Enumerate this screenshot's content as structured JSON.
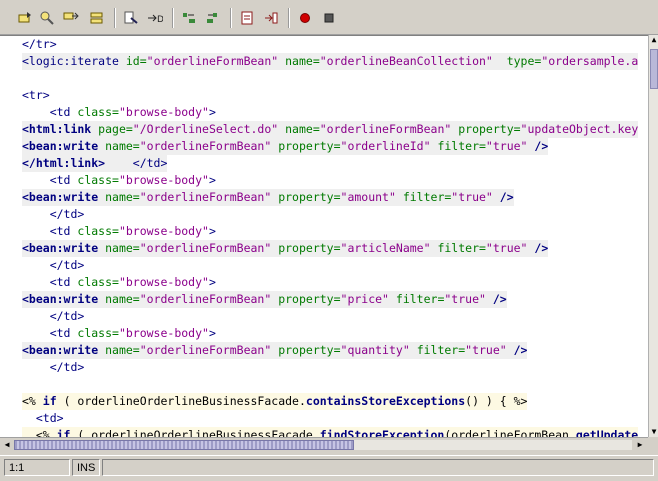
{
  "toolbar": {
    "buttons": [
      {
        "icon": "bookmark-toggle-icon"
      },
      {
        "icon": "find-icon"
      },
      {
        "icon": "next-bookmark-icon"
      },
      {
        "icon": "clear-bookmarks-icon"
      },
      {
        "icon": "format-icon"
      },
      {
        "icon": "step-into-icon"
      },
      {
        "icon": "shift-left-icon"
      },
      {
        "icon": "shift-right-icon"
      },
      {
        "icon": "start-macro-icon"
      },
      {
        "icon": "stop-macro-icon"
      },
      {
        "icon": "record-icon"
      },
      {
        "icon": "stop-icon"
      }
    ]
  },
  "editor": {
    "lines": [
      {
        "hl": "",
        "tokens": [
          {
            "c": "tag",
            "t": "</tr>"
          }
        ]
      },
      {
        "hl": "hl",
        "tokens": [
          {
            "c": "tag",
            "t": "<logic:iterate "
          },
          {
            "c": "attr",
            "t": "id="
          },
          {
            "c": "val",
            "t": "\"orderlineFormBean\" "
          },
          {
            "c": "attr",
            "t": "name="
          },
          {
            "c": "val",
            "t": "\"orderlineBeanCollection\"  "
          },
          {
            "c": "attr",
            "t": "type="
          },
          {
            "c": "val",
            "t": "\"ordersample.a"
          }
        ]
      },
      {
        "hl": "",
        "tokens": []
      },
      {
        "hl": "",
        "tokens": [
          {
            "c": "tag",
            "t": "<tr>"
          }
        ]
      },
      {
        "hl": "",
        "tokens": [
          {
            "c": "tag",
            "t": "    <td "
          },
          {
            "c": "attr",
            "t": "class="
          },
          {
            "c": "val",
            "t": "\"browse-body\""
          },
          {
            "c": "tag",
            "t": ">"
          }
        ]
      },
      {
        "hl": "hl",
        "tokens": [
          {
            "c": "jtag",
            "t": "<html:link "
          },
          {
            "c": "attr",
            "t": "page="
          },
          {
            "c": "val",
            "t": "\"/OrderlineSelect.do\" "
          },
          {
            "c": "attr",
            "t": "name="
          },
          {
            "c": "val",
            "t": "\"orderlineFormBean\" "
          },
          {
            "c": "attr",
            "t": "property="
          },
          {
            "c": "val",
            "t": "\"updateObject.key"
          }
        ]
      },
      {
        "hl": "hl",
        "tokens": [
          {
            "c": "jtag",
            "t": "<bean:write "
          },
          {
            "c": "attr",
            "t": "name="
          },
          {
            "c": "val",
            "t": "\"orderlineFormBean\" "
          },
          {
            "c": "attr",
            "t": "property="
          },
          {
            "c": "val",
            "t": "\"orderlineId\" "
          },
          {
            "c": "attr",
            "t": "filter="
          },
          {
            "c": "val",
            "t": "\"true\" "
          },
          {
            "c": "jtag",
            "t": "/>"
          }
        ]
      },
      {
        "hl": "hl",
        "tokens": [
          {
            "c": "jtag",
            "t": "</html:link>"
          },
          {
            "c": "tag",
            "t": "    </td>"
          }
        ]
      },
      {
        "hl": "",
        "tokens": [
          {
            "c": "tag",
            "t": "    <td "
          },
          {
            "c": "attr",
            "t": "class="
          },
          {
            "c": "val",
            "t": "\"browse-body\""
          },
          {
            "c": "tag",
            "t": ">"
          }
        ]
      },
      {
        "hl": "hl",
        "tokens": [
          {
            "c": "jtag",
            "t": "<bean:write "
          },
          {
            "c": "attr",
            "t": "name="
          },
          {
            "c": "val",
            "t": "\"orderlineFormBean\" "
          },
          {
            "c": "attr",
            "t": "property="
          },
          {
            "c": "val",
            "t": "\"amount\" "
          },
          {
            "c": "attr",
            "t": "filter="
          },
          {
            "c": "val",
            "t": "\"true\" "
          },
          {
            "c": "jtag",
            "t": "/>"
          }
        ]
      },
      {
        "hl": "",
        "tokens": [
          {
            "c": "tag",
            "t": "    </td>"
          }
        ]
      },
      {
        "hl": "",
        "tokens": [
          {
            "c": "tag",
            "t": "    <td "
          },
          {
            "c": "attr",
            "t": "class="
          },
          {
            "c": "val",
            "t": "\"browse-body\""
          },
          {
            "c": "tag",
            "t": ">"
          }
        ]
      },
      {
        "hl": "hl",
        "tokens": [
          {
            "c": "jtag",
            "t": "<bean:write "
          },
          {
            "c": "attr",
            "t": "name="
          },
          {
            "c": "val",
            "t": "\"orderlineFormBean\" "
          },
          {
            "c": "attr",
            "t": "property="
          },
          {
            "c": "val",
            "t": "\"articleName\" "
          },
          {
            "c": "attr",
            "t": "filter="
          },
          {
            "c": "val",
            "t": "\"true\" "
          },
          {
            "c": "jtag",
            "t": "/>"
          }
        ]
      },
      {
        "hl": "",
        "tokens": [
          {
            "c": "tag",
            "t": "    </td>"
          }
        ]
      },
      {
        "hl": "",
        "tokens": [
          {
            "c": "tag",
            "t": "    <td "
          },
          {
            "c": "attr",
            "t": "class="
          },
          {
            "c": "val",
            "t": "\"browse-body\""
          },
          {
            "c": "tag",
            "t": ">"
          }
        ]
      },
      {
        "hl": "hl",
        "tokens": [
          {
            "c": "jtag",
            "t": "<bean:write "
          },
          {
            "c": "attr",
            "t": "name="
          },
          {
            "c": "val",
            "t": "\"orderlineFormBean\" "
          },
          {
            "c": "attr",
            "t": "property="
          },
          {
            "c": "val",
            "t": "\"price\" "
          },
          {
            "c": "attr",
            "t": "filter="
          },
          {
            "c": "val",
            "t": "\"true\" "
          },
          {
            "c": "jtag",
            "t": "/>"
          }
        ]
      },
      {
        "hl": "",
        "tokens": [
          {
            "c": "tag",
            "t": "    </td>"
          }
        ]
      },
      {
        "hl": "",
        "tokens": [
          {
            "c": "tag",
            "t": "    <td "
          },
          {
            "c": "attr",
            "t": "class="
          },
          {
            "c": "val",
            "t": "\"browse-body\""
          },
          {
            "c": "tag",
            "t": ">"
          }
        ]
      },
      {
        "hl": "hl",
        "tokens": [
          {
            "c": "jtag",
            "t": "<bean:write "
          },
          {
            "c": "attr",
            "t": "name="
          },
          {
            "c": "val",
            "t": "\"orderlineFormBean\" "
          },
          {
            "c": "attr",
            "t": "property="
          },
          {
            "c": "val",
            "t": "\"quantity\" "
          },
          {
            "c": "attr",
            "t": "filter="
          },
          {
            "c": "val",
            "t": "\"true\" "
          },
          {
            "c": "jtag",
            "t": "/>"
          }
        ]
      },
      {
        "hl": "",
        "tokens": [
          {
            "c": "tag",
            "t": "    </td>"
          }
        ]
      },
      {
        "hl": "",
        "tokens": []
      },
      {
        "hl": "hlj",
        "tokens": [
          {
            "c": "plain",
            "t": "<% "
          },
          {
            "c": "kw",
            "t": "if"
          },
          {
            "c": "plain",
            "t": " ( orderlineOrderlineBusinessFacade."
          },
          {
            "c": "kw",
            "t": "containsStoreExceptions"
          },
          {
            "c": "plain",
            "t": "() ) { %>"
          }
        ]
      },
      {
        "hl": "",
        "tokens": [
          {
            "c": "tag",
            "t": "  <td>"
          }
        ]
      },
      {
        "hl": "hlj",
        "tokens": [
          {
            "c": "plain",
            "t": "  <% "
          },
          {
            "c": "kw",
            "t": "if"
          },
          {
            "c": "plain",
            "t": " ( orderlineOrderlineBusinessFacade."
          },
          {
            "c": "kw",
            "t": "findStoreException"
          },
          {
            "c": "plain",
            "t": "(orderlineFormBean."
          },
          {
            "c": "kw",
            "t": "getUpdate"
          }
        ]
      }
    ]
  },
  "status": {
    "position": "1:1",
    "mode": "INS"
  }
}
